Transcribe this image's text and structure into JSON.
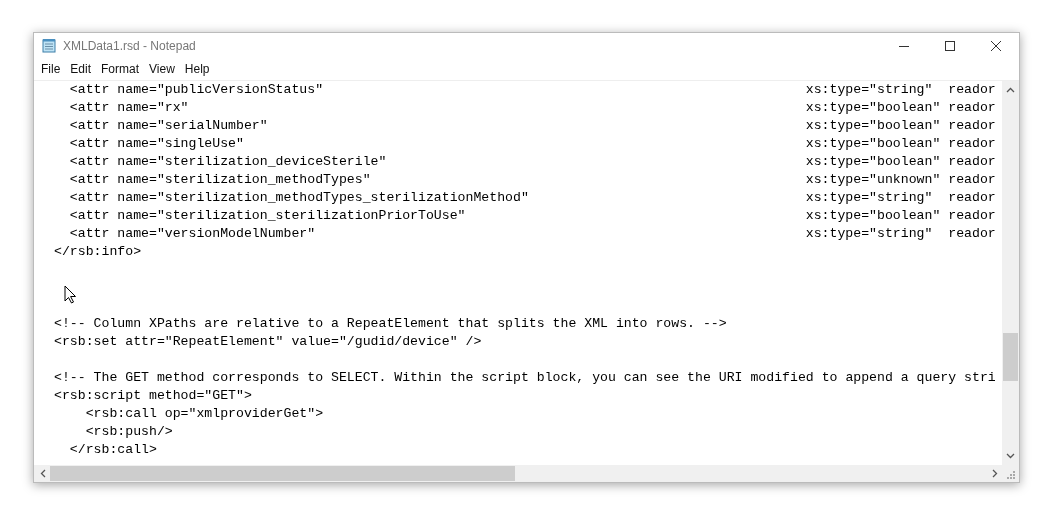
{
  "window": {
    "title": "XMLData1.rsd - Notepad"
  },
  "menu": [
    "File",
    "Edit",
    "Format",
    "View",
    "Help"
  ],
  "lines": [
    {
      "kind": "code",
      "text": "  <attr name=\"publicVersionStatus\"",
      "column_2": "xs:type=\"string\"  reador"
    },
    {
      "kind": "code",
      "text": "  <attr name=\"rx\"",
      "column_2": "xs:type=\"boolean\" reador"
    },
    {
      "kind": "code",
      "text": "  <attr name=\"serialNumber\"",
      "column_2": "xs:type=\"boolean\" reador"
    },
    {
      "kind": "code",
      "text": "  <attr name=\"singleUse\"",
      "column_2": "xs:type=\"boolean\" reador"
    },
    {
      "kind": "code",
      "text": "  <attr name=\"sterilization_deviceSterile\"",
      "column_2": "xs:type=\"boolean\" reador"
    },
    {
      "kind": "code",
      "text": "  <attr name=\"sterilization_methodTypes\"",
      "column_2": "xs:type=\"unknown\" reador"
    },
    {
      "kind": "code",
      "text": "  <attr name=\"sterilization_methodTypes_sterilizationMethod\"",
      "column_2": "xs:type=\"string\"  reador"
    },
    {
      "kind": "code",
      "text": "  <attr name=\"sterilization_sterilizationPriorToUse\"",
      "column_2": "xs:type=\"boolean\" reador"
    },
    {
      "kind": "code",
      "text": "  <attr name=\"versionModelNumber\"",
      "column_2": "xs:type=\"string\"  reador"
    },
    {
      "kind": "code",
      "text": "</rsb:info>"
    },
    {
      "kind": "blank"
    },
    {
      "kind": "blank"
    },
    {
      "kind": "blank"
    },
    {
      "kind": "code",
      "text": "<!-- Column XPaths are relative to a RepeatElement that splits the XML into rows. -->"
    },
    {
      "kind": "code",
      "text": "<rsb:set attr=\"RepeatElement\" value=\"/gudid/device\" />"
    },
    {
      "kind": "blank"
    },
    {
      "kind": "code",
      "text": "<!-- The GET method corresponds to SELECT. Within the script block, you can see the URI modified to append a query stri"
    },
    {
      "kind": "code",
      "text": "<rsb:script method=\"GET\">"
    },
    {
      "kind": "code",
      "text": "    <rsb:call op=\"xmlproviderGet\">"
    },
    {
      "kind": "code",
      "text": "    <rsb:push/>"
    },
    {
      "kind": "code",
      "text": "  </rsb:call>"
    }
  ]
}
